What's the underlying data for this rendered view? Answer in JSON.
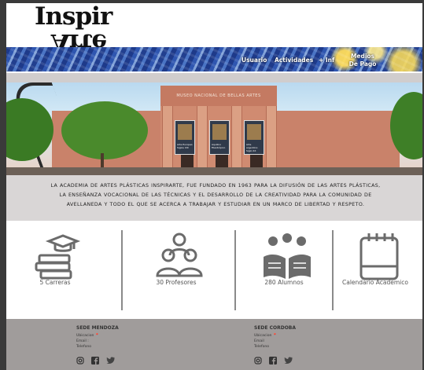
{
  "brand": {
    "logo_top": "Inspir",
    "logo_bottom": "Arte"
  },
  "nav": {
    "items": [
      {
        "label": "Usuario"
      },
      {
        "label": "Actividades"
      },
      {
        "label": "+ Inf"
      },
      {
        "label": "Medios De Pago"
      }
    ]
  },
  "hero": {
    "sign_text": "MUSEO NACIONAL DE BELLAS ARTES",
    "banners": [
      "Arte Europeo Siglos XIII",
      "Aquilino Filantrópico",
      "Arte argentino Siglo XX"
    ]
  },
  "intro": {
    "text": "LA ACADEMIA DE ARTES PLÁSTICAS INSPIRARTE, FUE FUNDADO EN 1963 PARA LA DIFUSIÓN DE LAS ARTES PLÁSTICAS, LA ENSEÑANZA VOCACIONAL DE LAS TÉCNICAS Y EL DESARROLLO DE LA CREATIVIDAD PARA LA COMUNIDAD DE AVELLANEDA Y TODO EL QUE SE ACERCA A TRABAJAR Y ESTUDIAR EN UN MARCO DE LIBERTAD Y RESPETO."
  },
  "stats": [
    {
      "label": "5 Carreras",
      "icon": "graduation-books-icon"
    },
    {
      "label": "30 Profesores",
      "icon": "teachers-group-icon"
    },
    {
      "label": "280 Alumnos",
      "icon": "students-reading-icon"
    },
    {
      "label": "Calendario Academico",
      "icon": "notepad-calendar-icon"
    }
  ],
  "footer": {
    "sedes": [
      {
        "title": "SEDE MENDOZA",
        "ubicacion": "Ubicacion",
        "email": "Email :",
        "telefono": "Telefono"
      },
      {
        "title": "SEDE CORDOBA",
        "ubicacion": "Ubicacion",
        "email": "Email",
        "telefono": "Telefono"
      }
    ],
    "social_icons": [
      "instagram-icon",
      "facebook-icon",
      "twitter-icon"
    ]
  },
  "colors": {
    "nav_blue": "#2a4a9a",
    "footer_gray": "#a09c9b",
    "intro_bg": "#d9d6d6"
  }
}
